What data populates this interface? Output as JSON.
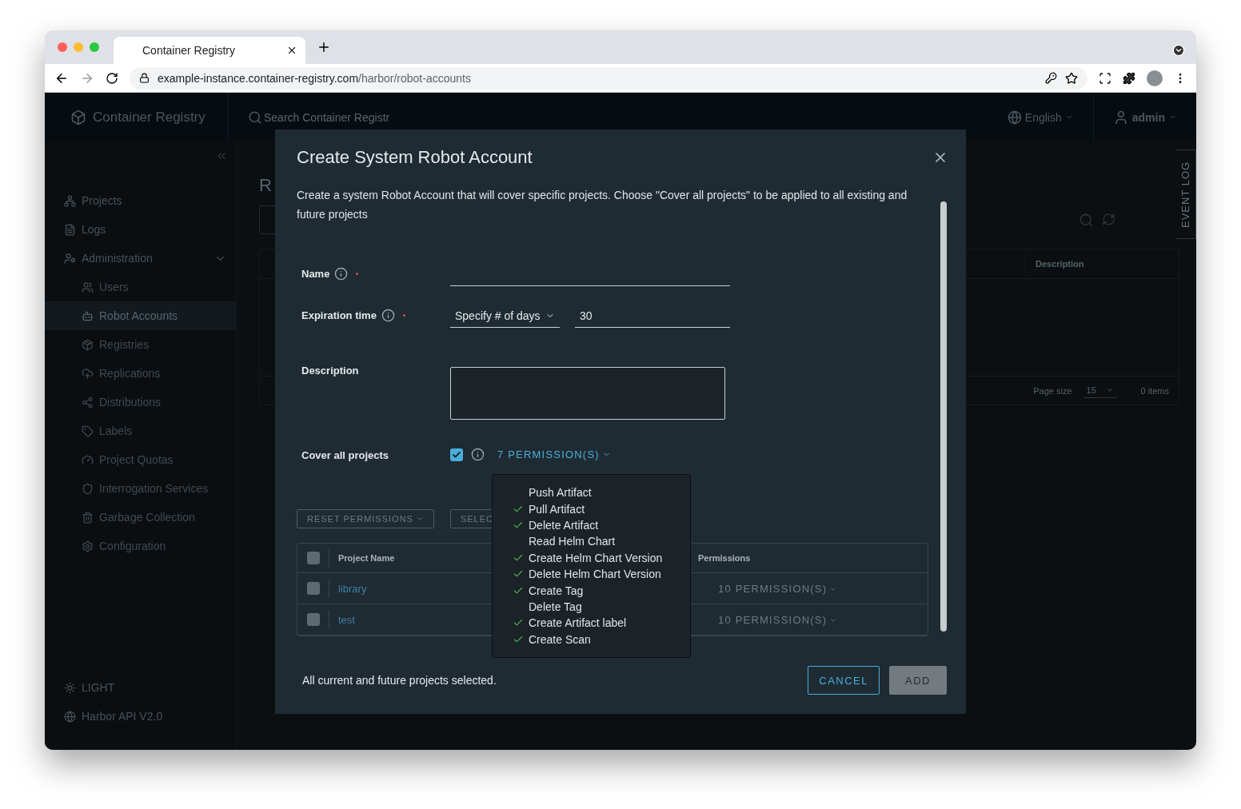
{
  "browser": {
    "tab_title": "Container Registry",
    "url_host": "example-instance.container-registry.com",
    "url_path": "/harbor/robot-accounts"
  },
  "header": {
    "app_name": "Container Registry",
    "search_placeholder": "Search Container Registr",
    "language": "English",
    "user": "admin"
  },
  "sidebar": {
    "items": [
      {
        "label": "Projects",
        "selected": false
      },
      {
        "label": "Logs",
        "selected": false
      },
      {
        "label": "Administration",
        "selected": false,
        "expanded": true,
        "children": [
          {
            "label": "Users",
            "selected": false
          },
          {
            "label": "Robot Accounts",
            "selected": true
          },
          {
            "label": "Registries",
            "selected": false
          },
          {
            "label": "Replications",
            "selected": false
          },
          {
            "label": "Distributions",
            "selected": false
          },
          {
            "label": "Labels",
            "selected": false
          },
          {
            "label": "Project Quotas",
            "selected": false
          },
          {
            "label": "Interrogation Services",
            "selected": false
          },
          {
            "label": "Garbage Collection",
            "selected": false
          },
          {
            "label": "Configuration",
            "selected": false
          }
        ]
      }
    ],
    "footer": [
      "LIGHT",
      "Harbor API V2.0"
    ]
  },
  "page": {
    "title": "R",
    "table": {
      "columns": [
        "Description"
      ],
      "page_size_label": "Page size",
      "page_size": "15",
      "item_count": "0 items"
    },
    "event_log": "EVENT LOG"
  },
  "dialog": {
    "title": "Create System Robot Account",
    "intro": "Create a system Robot Account that will cover specific projects. Choose \"Cover all projects\" to be applied to all existing and future projects",
    "fields": [
      {
        "kind": "text",
        "label": "Name",
        "required": true,
        "info": true
      },
      {
        "kind": "expiration",
        "label": "Expiration time",
        "required": true,
        "info": true,
        "select": "Specify # of days",
        "value": "30"
      },
      {
        "kind": "textarea",
        "label": "Description",
        "required": false,
        "info": false
      },
      {
        "kind": "cover",
        "label": "Cover all projects",
        "required": false,
        "info": true,
        "checked": true,
        "link": "7 PERMISSION(S)"
      }
    ],
    "permissions_menu": [
      {
        "label": "Push Artifact",
        "checked": false
      },
      {
        "label": "Pull Artifact",
        "checked": true
      },
      {
        "label": "Delete Artifact",
        "checked": true
      },
      {
        "label": "Read Helm Chart",
        "checked": false
      },
      {
        "label": "Create Helm Chart Version",
        "checked": true
      },
      {
        "label": "Delete Helm Chart Version",
        "checked": true
      },
      {
        "label": "Create Tag",
        "checked": true
      },
      {
        "label": "Delete Tag",
        "checked": false
      },
      {
        "label": "Create Artifact label",
        "checked": true
      },
      {
        "label": "Create Scan",
        "checked": true
      }
    ],
    "actions": [
      "RESET PERMISSIONS",
      "SELEC"
    ],
    "projects_table": {
      "columns": [
        "Project Name",
        "Permissions"
      ],
      "all_checked": false,
      "rows": [
        {
          "name": "library",
          "permissions": "10 PERMISSION(S)",
          "selected": false
        },
        {
          "name": "test",
          "permissions": "10 PERMISSION(S)",
          "selected": false
        }
      ]
    },
    "status": "All current and future projects selected.",
    "buttons": [
      {
        "label": "CANCEL",
        "disabled": false
      },
      {
        "label": "ADD",
        "disabled": true
      }
    ]
  }
}
